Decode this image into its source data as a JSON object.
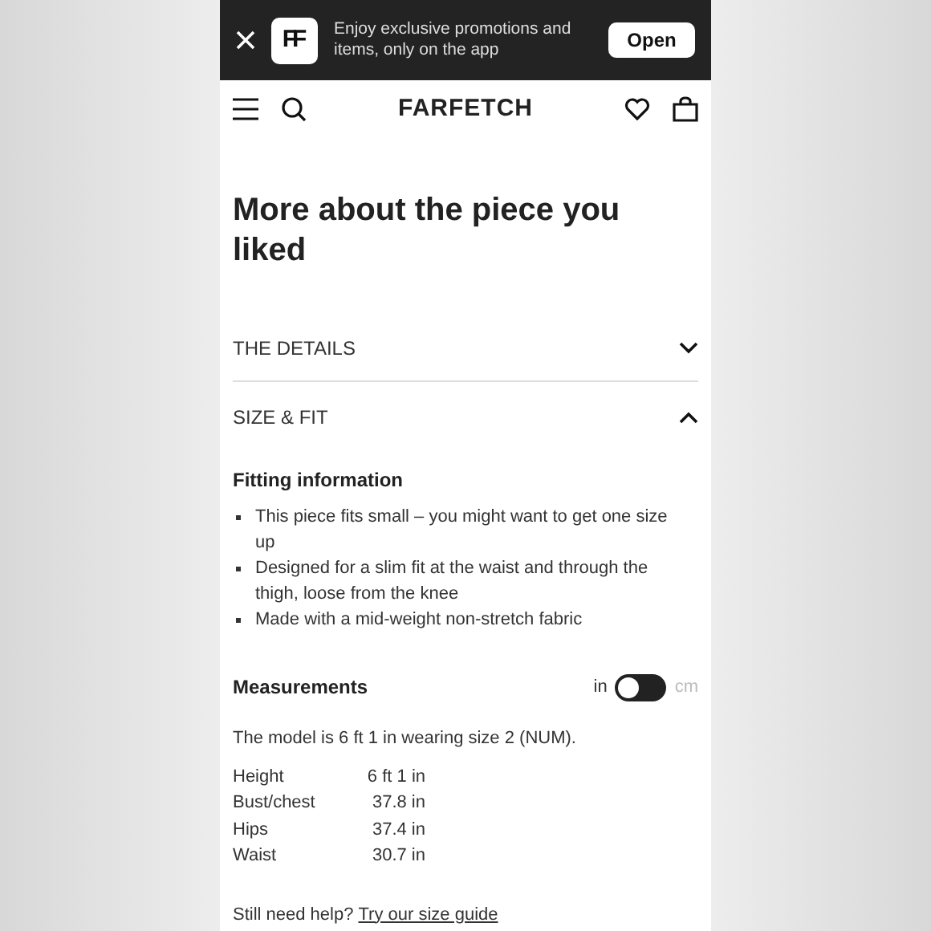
{
  "app_banner": {
    "text": "Enjoy exclusive promotions and items, only on the app",
    "logo": "FF",
    "button": "Open"
  },
  "nav": {
    "brand": "FARFETCH"
  },
  "heading": "More about the piece you liked",
  "sections": [
    {
      "title": "THE DETAILS",
      "expanded": false
    },
    {
      "title": "SIZE & FIT",
      "expanded": true
    }
  ],
  "fitting": {
    "title": "Fitting information",
    "bullets": [
      "This piece fits small – you might want to get one size up",
      "Designed for a slim fit at the waist and through the thigh, loose from the knee",
      "Made with a mid-weight non-stretch fabric"
    ]
  },
  "measurements": {
    "title": "Measurements",
    "units": [
      {
        "label": "in",
        "selected": true
      },
      {
        "label": "cm",
        "selected": false
      }
    ],
    "model_note": "The model is 6 ft 1 in wearing size 2 (NUM).",
    "rows": [
      {
        "label": "Height",
        "value": "6 ft 1 in"
      },
      {
        "label": "Bust/chest",
        "value": "37.8 in"
      },
      {
        "label": "Hips",
        "value": "37.4 in"
      },
      {
        "label": "Waist",
        "value": "30.7 in"
      }
    ]
  },
  "help": {
    "text": "Still need help?",
    "link": "Try our size guide"
  }
}
